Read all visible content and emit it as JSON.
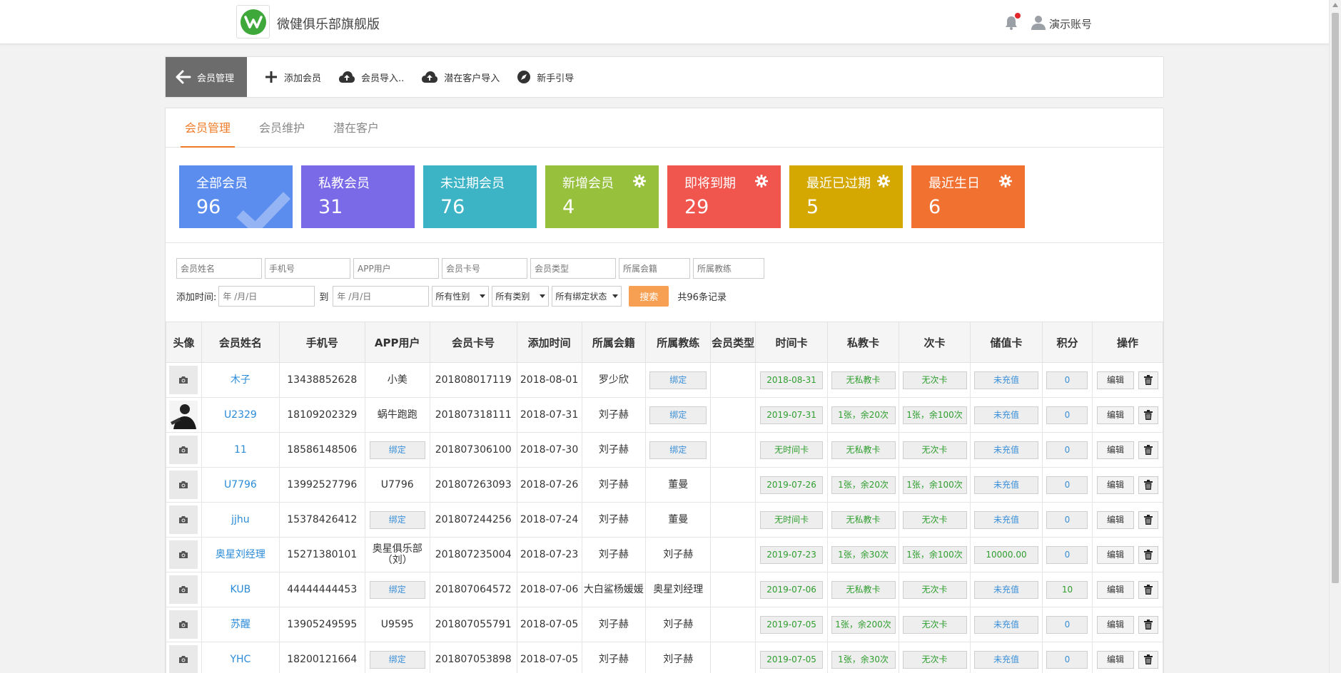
{
  "header": {
    "app_title": "微健俱乐部旗舰版",
    "user_name": "演示账号"
  },
  "toolbar": {
    "back_label": "会员管理",
    "items": [
      {
        "label": "添加会员",
        "icon": "plus-icon"
      },
      {
        "label": "会员导入..",
        "icon": "cloud-upload-icon"
      },
      {
        "label": "潜在客户导入",
        "icon": "cloud-upload-icon"
      },
      {
        "label": "新手引导",
        "icon": "compass-icon"
      }
    ]
  },
  "tabs": [
    "会员管理",
    "会员维护",
    "潜在客户"
  ],
  "cards": [
    {
      "label": "全部会员",
      "value": "96",
      "color": "#5b8def",
      "icon": "check-icon"
    },
    {
      "label": "私教会员",
      "value": "31",
      "color": "#7b6ae8",
      "icon": ""
    },
    {
      "label": "未过期会员",
      "value": "76",
      "color": "#3db3c6",
      "icon": ""
    },
    {
      "label": "新增会员",
      "value": "4",
      "color": "#97c03d",
      "icon": "gear-icon"
    },
    {
      "label": "即将到期",
      "value": "29",
      "color": "#f0554e",
      "icon": "gear-icon"
    },
    {
      "label": "最近已过期",
      "value": "5",
      "color": "#d4a800",
      "icon": "gear-icon"
    },
    {
      "label": "最近生日",
      "value": "6",
      "color": "#f07130",
      "icon": "gear-icon"
    }
  ],
  "filters": {
    "name_placeholder": "会员姓名",
    "phone_placeholder": "手机号",
    "app_user_placeholder": "APP用户",
    "card_no_placeholder": "会员卡号",
    "member_type_placeholder": "会员类型",
    "club_placeholder": "所属会籍",
    "coach_placeholder": "所属教练",
    "add_time_label": "添加时间:",
    "date_from_placeholder": "年 /月/日",
    "to_label": "到",
    "date_to_placeholder": "年 /月/日",
    "gender_select": "所有性别",
    "category_select": "所有类别",
    "bind_select": "所有绑定状态",
    "search_label": "搜索",
    "total_text": "共96条记录"
  },
  "table": {
    "headers": [
      "头像",
      "会员姓名",
      "手机号",
      "APP用户",
      "会员卡号",
      "添加时间",
      "所属会籍",
      "所属教练",
      "会员类型",
      "时间卡",
      "私教卡",
      "次卡",
      "储值卡",
      "积分",
      "操作"
    ],
    "bind_label": "绑定",
    "edit_label": "编辑",
    "rows": [
      {
        "name": "木子",
        "phone": "13438852628",
        "app": "小美",
        "app_bind": false,
        "card_no": "201808017119",
        "date": "2018-08-01",
        "club": "罗少欣",
        "coach": "",
        "coach_bind": true,
        "time_card": "2018-08-31",
        "pt_card": "无私教卡",
        "count_card": "无次卡",
        "stored": "未充值",
        "points": "0",
        "photo": false
      },
      {
        "name": "U2329",
        "phone": "18109202329",
        "app": "蜗牛跑跑",
        "app_bind": false,
        "card_no": "201807318111",
        "date": "2018-07-31",
        "club": "刘子赫",
        "coach": "",
        "coach_bind": true,
        "time_card": "2019-07-31",
        "pt_card": "1张，余20次",
        "count_card": "1张，余100次",
        "stored": "未充值",
        "points": "0",
        "photo": true
      },
      {
        "name": "11",
        "phone": "18586148506",
        "app": "",
        "app_bind": true,
        "card_no": "201807306100",
        "date": "2018-07-30",
        "club": "刘子赫",
        "coach": "",
        "coach_bind": true,
        "time_card": "无时间卡",
        "pt_card": "无私教卡",
        "count_card": "无次卡",
        "stored": "未充值",
        "points": "0",
        "photo": false
      },
      {
        "name": "U7796",
        "phone": "13992527796",
        "app": "U7796",
        "app_bind": false,
        "card_no": "201807263093",
        "date": "2018-07-26",
        "club": "刘子赫",
        "coach": "董曼",
        "coach_bind": false,
        "time_card": "2019-07-26",
        "pt_card": "1张，余20次",
        "count_card": "1张，余100次",
        "stored": "未充值",
        "points": "0",
        "photo": false
      },
      {
        "name": "jjhu",
        "phone": "15378426412",
        "app": "",
        "app_bind": true,
        "card_no": "201807244256",
        "date": "2018-07-24",
        "club": "刘子赫",
        "coach": "董曼",
        "coach_bind": false,
        "time_card": "无时间卡",
        "pt_card": "无私教卡",
        "count_card": "无次卡",
        "stored": "未充值",
        "points": "0",
        "photo": false
      },
      {
        "name": "奥星刘经理",
        "phone": "15271380101",
        "app": "奥星俱乐部（刘）",
        "app_bind": false,
        "card_no": "201807235004",
        "date": "2018-07-23",
        "club": "刘子赫",
        "coach": "刘子赫",
        "coach_bind": false,
        "time_card": "2019-07-23",
        "pt_card": "1张，余30次",
        "count_card": "1张，余100次",
        "stored": "10000.00",
        "points": "0",
        "photo": false
      },
      {
        "name": "KUB",
        "phone": "44444444453",
        "app": "",
        "app_bind": true,
        "card_no": "201807064572",
        "date": "2018-07-06",
        "club": "大白鲨杨媛媛",
        "coach": "奥星刘经理",
        "coach_bind": false,
        "time_card": "2019-07-06",
        "pt_card": "无私教卡",
        "count_card": "无次卡",
        "stored": "未充值",
        "points": "10",
        "photo": false
      },
      {
        "name": "苏醒",
        "phone": "13905249595",
        "app": "U9595",
        "app_bind": false,
        "card_no": "201807055791",
        "date": "2018-07-05",
        "club": "刘子赫",
        "coach": "刘子赫",
        "coach_bind": false,
        "time_card": "2019-07-05",
        "pt_card": "1张，余200次",
        "count_card": "无次卡",
        "stored": "未充值",
        "points": "0",
        "photo": false
      },
      {
        "name": "YHC",
        "phone": "18200121664",
        "app": "",
        "app_bind": true,
        "card_no": "201807053898",
        "date": "2018-07-05",
        "club": "刘子赫",
        "coach": "刘子赫",
        "coach_bind": false,
        "time_card": "2019-07-05",
        "pt_card": "1张，余30次",
        "count_card": "无次卡",
        "stored": "未充值",
        "points": "0",
        "photo": false
      }
    ]
  }
}
